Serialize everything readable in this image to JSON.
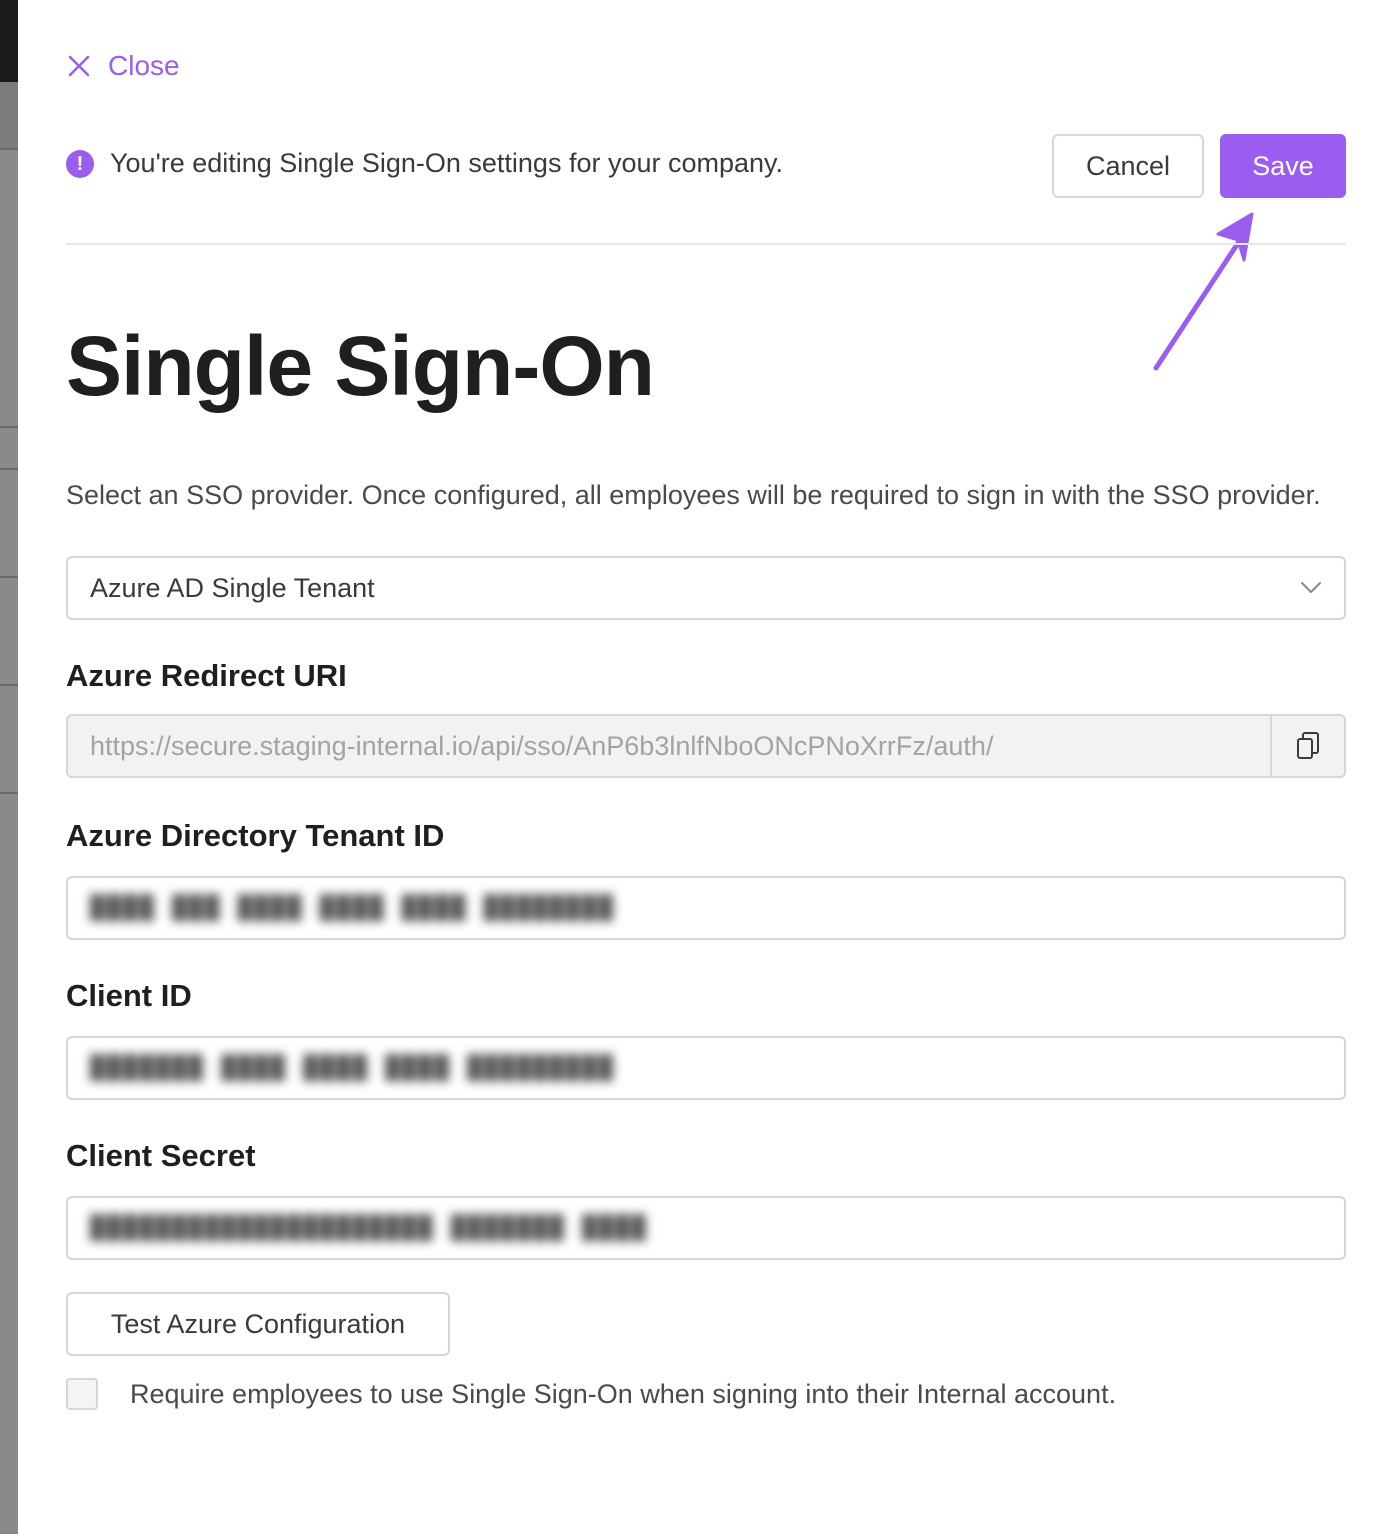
{
  "close": {
    "label": "Close"
  },
  "banner": {
    "message": "You're editing Single Sign-On settings for your company.",
    "cancel_label": "Cancel",
    "save_label": "Save"
  },
  "page": {
    "title": "Single Sign-On",
    "description": "Select an SSO provider. Once configured, all employees will be required to sign in with the SSO provider."
  },
  "provider_select": {
    "selected": "Azure AD Single Tenant"
  },
  "fields": {
    "redirect_uri": {
      "label": "Azure Redirect URI",
      "value": "https://secure.staging-internal.io/api/sso/AnP6b3lnlfNboONcPNoXrrFz/auth/"
    },
    "tenant_id": {
      "label": "Azure Directory Tenant ID"
    },
    "client_id": {
      "label": "Client ID"
    },
    "client_secret": {
      "label": "Client Secret"
    }
  },
  "test_button": {
    "label": "Test Azure Configuration"
  },
  "require_sso": {
    "label": "Require employees to use Single Sign-On when signing into their Internal account.",
    "checked": false
  },
  "colors": {
    "accent": "#9b5cf0",
    "border": "#d6d6d6",
    "readonly_bg": "#f2f2f2"
  }
}
